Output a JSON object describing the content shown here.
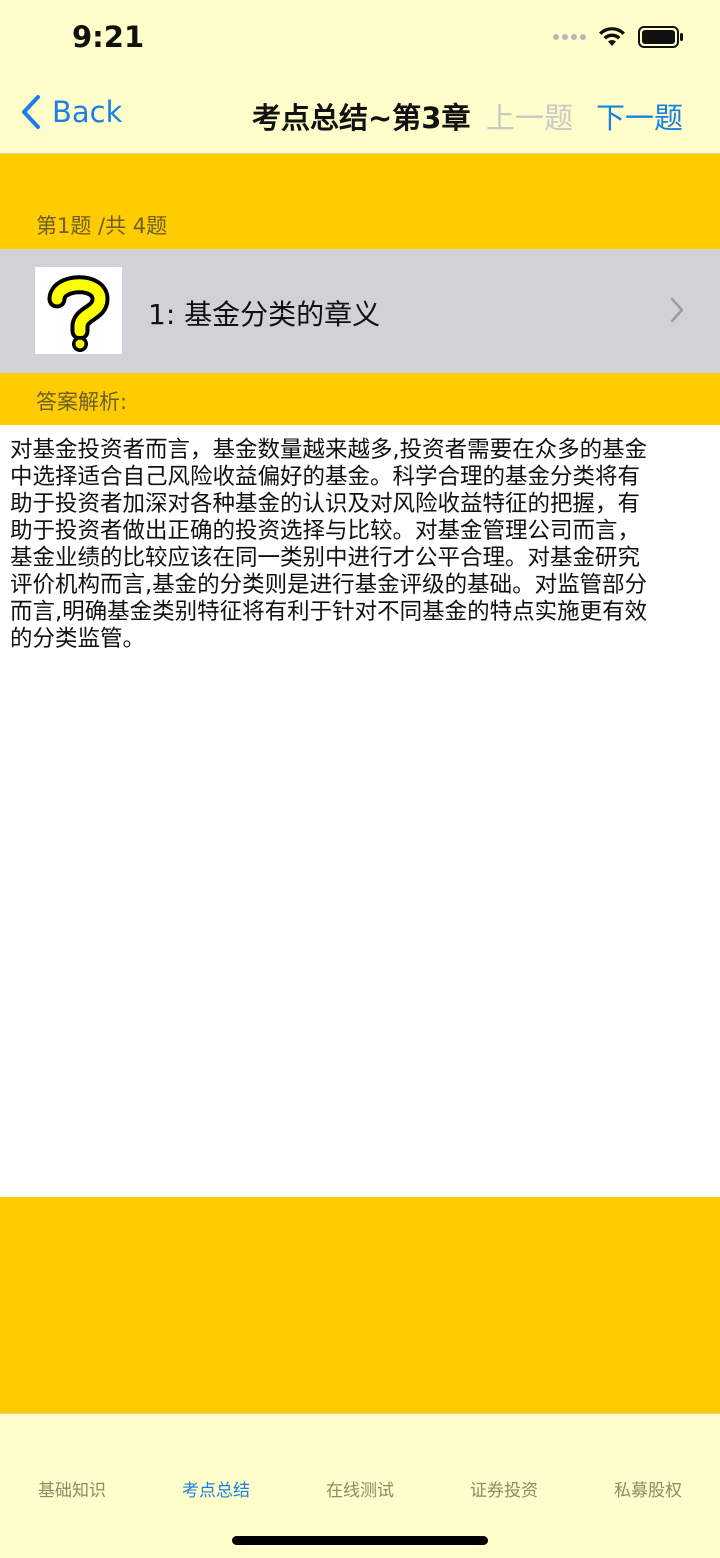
{
  "status_bar": {
    "time": "9:21"
  },
  "nav": {
    "back_label": "Back",
    "title": "考点总结~第3章",
    "prev_label": "上一题",
    "next_label": "下一题"
  },
  "question": {
    "counter": "第1题 /共 4题",
    "title": "1: 基金分类的章义",
    "icon": "question-mark-icon"
  },
  "answer": {
    "label": "答案解析:",
    "text": "对基金投资者而言，基金数量越来越多,投资者需要在众多的基金\n中选择适合自己风险收益偏好的基金。科学合理的基金分类将有\n助于投资者加深对各种基金的认识及对风险收益特征的把握，有\n助于投资者做出正确的投资选择与比较。对基金管理公司而言，\n基金业绩的比较应该在同一类别中进行才公平合理。对基金研究\n评价机构而言,基金的分类则是进行基金评级的基础。对监管部分\n而言,明确基金类别特征将有利于针对不同基金的特点实施更有效\n的分类监管。"
  },
  "tabs": [
    {
      "label": "基础知识",
      "active": false
    },
    {
      "label": "考点总结",
      "active": true
    },
    {
      "label": "在线测试",
      "active": false
    },
    {
      "label": "证券投资",
      "active": false
    },
    {
      "label": "私募股权",
      "active": false
    }
  ],
  "colors": {
    "nav_background": "#FFFDC9",
    "accent_yellow": "#FFCC00",
    "row_gray": "#D1D1D6",
    "link_blue": "#1A80E6",
    "disabled_gray": "#C8C8C8"
  }
}
